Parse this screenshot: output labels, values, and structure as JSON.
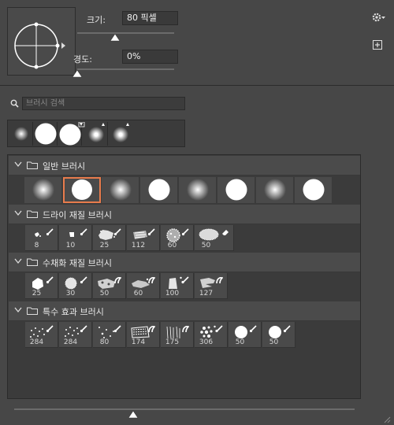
{
  "brush_settings": {
    "size_label": "크기:",
    "size_value": "80 픽셀",
    "size_fraction": 0.27,
    "hardness_label": "경도:",
    "hardness_value": "0%",
    "hardness_fraction": 0.0
  },
  "search": {
    "placeholder": "브러시 검색",
    "icon": "search-icon"
  },
  "header_icons": {
    "gear": "gear-icon",
    "new_preset": "new-preset-icon"
  },
  "recent_brushes": [
    {
      "kind": "soft"
    },
    {
      "kind": "hard"
    },
    {
      "kind": "hard"
    },
    {
      "kind": "soft"
    },
    {
      "kind": "soft"
    }
  ],
  "groups": [
    {
      "name": "일반 브러시",
      "brushes": [
        {
          "kind": "soft"
        },
        {
          "kind": "hard",
          "selected": true
        },
        {
          "kind": "soft"
        },
        {
          "kind": "hard"
        },
        {
          "kind": "soft"
        },
        {
          "kind": "hard"
        },
        {
          "kind": "soft"
        },
        {
          "kind": "hard"
        }
      ]
    },
    {
      "name": "드라이 재질 브러시",
      "brushes": [
        {
          "size": "8"
        },
        {
          "size": "10"
        },
        {
          "size": "25"
        },
        {
          "size": "112"
        },
        {
          "size": "60"
        },
        {
          "size": "50"
        }
      ]
    },
    {
      "name": "수채화 재질 브러시",
      "brushes": [
        {
          "size": "25"
        },
        {
          "size": "30"
        },
        {
          "size": "50"
        },
        {
          "size": "60"
        },
        {
          "size": "100"
        },
        {
          "size": "127"
        }
      ]
    },
    {
      "name": "특수 효과 브러시",
      "brushes": [
        {
          "size": "284"
        },
        {
          "size": "284"
        },
        {
          "size": "80"
        },
        {
          "size": "174"
        },
        {
          "size": "175"
        },
        {
          "size": "306"
        },
        {
          "size": "50"
        },
        {
          "size": "50"
        }
      ]
    }
  ],
  "preview_slider_fraction": 0.35
}
